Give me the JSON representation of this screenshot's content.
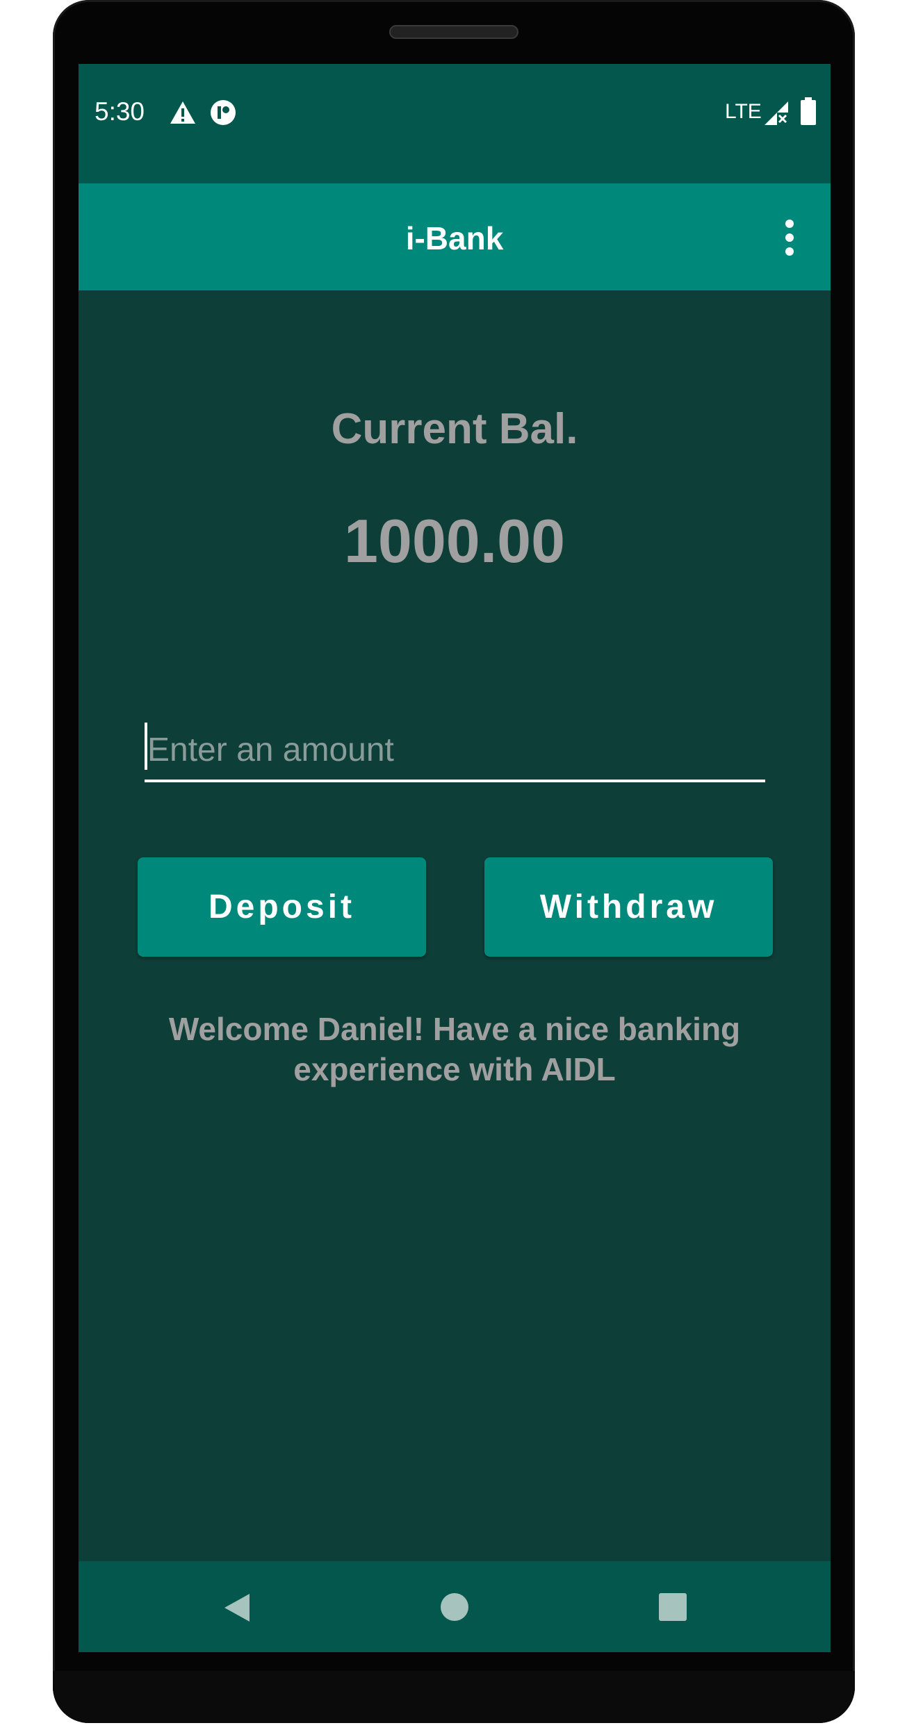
{
  "status_bar": {
    "time": "5:30",
    "icons": [
      "warning-icon",
      "sync-icon"
    ],
    "network": "LTE",
    "system_icons": [
      "signal-no-service-icon",
      "battery-icon"
    ]
  },
  "app_bar": {
    "title": "i-Bank",
    "menu_icon": "more-vert-icon"
  },
  "main": {
    "balance_label": "Current Bal.",
    "balance_value": "1000.00",
    "amount_input": {
      "placeholder": "Enter an amount",
      "value": ""
    },
    "deposit_label": "Deposit",
    "withdraw_label": "Withdraw",
    "welcome_message": "Welcome Daniel! Have a nice banking experience with AIDL"
  },
  "nav_bar": {
    "buttons": [
      "back-icon",
      "home-icon",
      "recents-icon"
    ]
  },
  "colors": {
    "status_bar": "#03574c",
    "app_bar": "#00897b",
    "background": "#0d3e38",
    "button": "#00897b",
    "text_muted": "#a0a0a0"
  }
}
